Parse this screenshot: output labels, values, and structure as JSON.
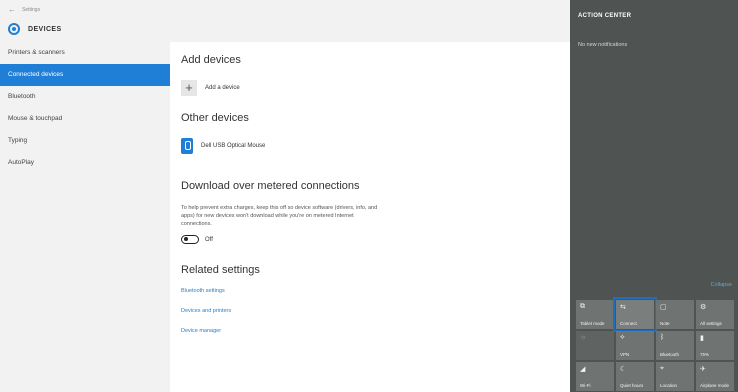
{
  "window": {
    "back_text": "Settings",
    "header_title": "DEVICES"
  },
  "sidebar": {
    "items": [
      {
        "label": "Printers & scanners",
        "active": false
      },
      {
        "label": "Connected devices",
        "active": true
      },
      {
        "label": "Bluetooth",
        "active": false
      },
      {
        "label": "Mouse & touchpad",
        "active": false
      },
      {
        "label": "Typing",
        "active": false
      },
      {
        "label": "AutoPlay",
        "active": false
      }
    ]
  },
  "main": {
    "add_devices_title": "Add devices",
    "add_device_label": "Add a device",
    "other_devices_title": "Other devices",
    "device_name": "Dell USB Optical Mouse",
    "metered_title": "Download over metered connections",
    "metered_desc": "To help prevent extra charges, keep this off so device software (drivers, info, and apps) for new devices won't download while you're on metered Internet connections.",
    "toggle_state": "Off",
    "related_title": "Related settings",
    "links": [
      "Bluetooth settings",
      "Devices and printers",
      "Device manager"
    ]
  },
  "action_center": {
    "title": "ACTION CENTER",
    "notifications": "No new notifications",
    "collapse_label": "Collapse",
    "tiles": [
      {
        "icon": "tablet-mode-icon",
        "glyph": "⧉",
        "label": "Tablet mode",
        "dim": false
      },
      {
        "icon": "connect-icon",
        "glyph": "⇆",
        "label": "Connect",
        "dim": false,
        "highlight": true
      },
      {
        "icon": "note-icon",
        "glyph": "▢",
        "label": "Note",
        "dim": false
      },
      {
        "icon": "all-settings-icon",
        "glyph": "⚙",
        "label": "All settings",
        "dim": false
      },
      {
        "icon": "brightness-icon",
        "glyph": "☼",
        "label": "",
        "dim": true
      },
      {
        "icon": "vpn-icon",
        "glyph": "⟡",
        "label": "VPN",
        "dim": false
      },
      {
        "icon": "bluetooth-icon",
        "glyph": "ᛒ",
        "label": "Bluetooth",
        "dim": false
      },
      {
        "icon": "battery-icon",
        "glyph": "▮",
        "label": "75%",
        "dim": false
      },
      {
        "icon": "wifi-icon",
        "glyph": "◢",
        "label": "Wi-Fi",
        "dim": false
      },
      {
        "icon": "quiet-hours-icon",
        "glyph": "☾",
        "label": "Quiet hours",
        "dim": false
      },
      {
        "icon": "location-icon",
        "glyph": "⌖",
        "label": "Location",
        "dim": false
      },
      {
        "icon": "airplane-mode-icon",
        "glyph": "✈",
        "label": "Airplane mode",
        "dim": false
      }
    ]
  },
  "colors": {
    "accent": "#1f7fd6",
    "action_center_bg": "#4f5351",
    "highlight_outline": "#1f6fbf"
  }
}
